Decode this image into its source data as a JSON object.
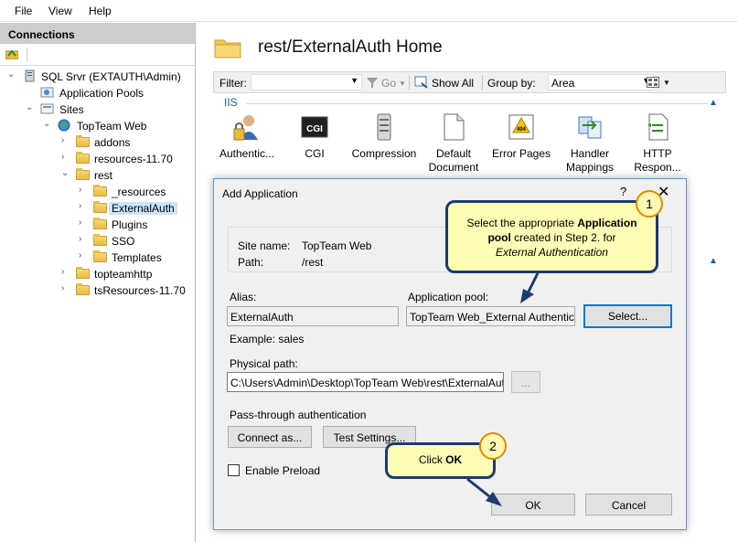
{
  "menu": {
    "file": "File",
    "view": "View",
    "help": "Help"
  },
  "connections": {
    "header": "Connections",
    "tree": [
      {
        "label": "SQL Srvr (EXTAUTH\\Admin)",
        "icon": "server-icon",
        "arrow": "⌄"
      },
      {
        "label": "Application Pools",
        "icon": "application-pools-icon",
        "arrow": ""
      },
      {
        "label": "Sites",
        "icon": "sites-icon",
        "arrow": "⌄"
      },
      {
        "label": "TopTeam Web",
        "icon": "globe-icon",
        "arrow": "⌄"
      },
      {
        "label": "addons",
        "icon": "folder-icon",
        "arrow": "›"
      },
      {
        "label": "resources-11.70",
        "icon": "folder-icon",
        "arrow": "›"
      },
      {
        "label": "rest",
        "icon": "folder-icon",
        "arrow": "⌄"
      },
      {
        "label": "_resources",
        "icon": "folder-icon",
        "arrow": "›"
      },
      {
        "label": "ExternalAuth",
        "icon": "folder-icon",
        "arrow": "›"
      },
      {
        "label": "Plugins",
        "icon": "folder-icon",
        "arrow": "›"
      },
      {
        "label": "SSO",
        "icon": "folder-icon",
        "arrow": "›"
      },
      {
        "label": "Templates",
        "icon": "folder-icon",
        "arrow": "›"
      },
      {
        "label": "topteamhttp",
        "icon": "folder-icon",
        "arrow": "›"
      },
      {
        "label": "tsResources-11.70",
        "icon": "folder-icon",
        "arrow": "›"
      }
    ]
  },
  "main": {
    "title": "rest/ExternalAuth Home",
    "filter_label": "Filter:",
    "go_label": "Go",
    "show_all_label": "Show All",
    "group_by_label": "Group by:",
    "group_by_value": "Area",
    "section_label": "IIS",
    "features": [
      {
        "label": "Authentic...",
        "icon": "authentication-icon"
      },
      {
        "label": "CGI",
        "icon": "cgi-icon"
      },
      {
        "label": "Compression",
        "icon": "compression-icon"
      },
      {
        "label": "Default Document",
        "icon": "default-document-icon"
      },
      {
        "label": "Error Pages",
        "icon": "error-pages-icon"
      },
      {
        "label": "Handler Mappings",
        "icon": "handler-mappings-icon"
      },
      {
        "label": "HTTP Respon...",
        "icon": "http-response-icon"
      }
    ]
  },
  "dialog": {
    "title": "Add Application",
    "help": "?",
    "close": "✕",
    "site_name_label": "Site name:",
    "site_name_value": "TopTeam Web",
    "path_label": "Path:",
    "path_value": "/rest",
    "alias_label": "Alias:",
    "alias_value": "ExternalAuth",
    "app_pool_label": "Application pool:",
    "app_pool_value": "TopTeam Web_External Authentication",
    "select_button": "Select...",
    "example_text": "Example: sales",
    "physical_path_label": "Physical path:",
    "physical_path_value": "C:\\Users\\Admin\\Desktop\\TopTeam Web\\rest\\ExternalAuth",
    "browse_button": "...",
    "pass_through_label": "Pass-through authentication",
    "connect_as_button": "Connect as...",
    "test_settings_button": "Test Settings...",
    "enable_preload_label": "Enable Preload",
    "ok_button": "OK",
    "cancel_button": "Cancel"
  },
  "callouts": {
    "one_number": "1",
    "one_a": "Select the appropriate ",
    "one_b": "Application pool",
    "one_c": " created in Step 2. for",
    "one_d": "External Authentication",
    "two_number": "2",
    "two_a": "Click ",
    "two_b": "OK"
  },
  "colors": {
    "accent": "#0078d7",
    "callout_fill": "#fefcb4",
    "callout_border": "#1e3a6e",
    "badge_border": "#e08b00",
    "section_blue": "#1a5fb4"
  }
}
